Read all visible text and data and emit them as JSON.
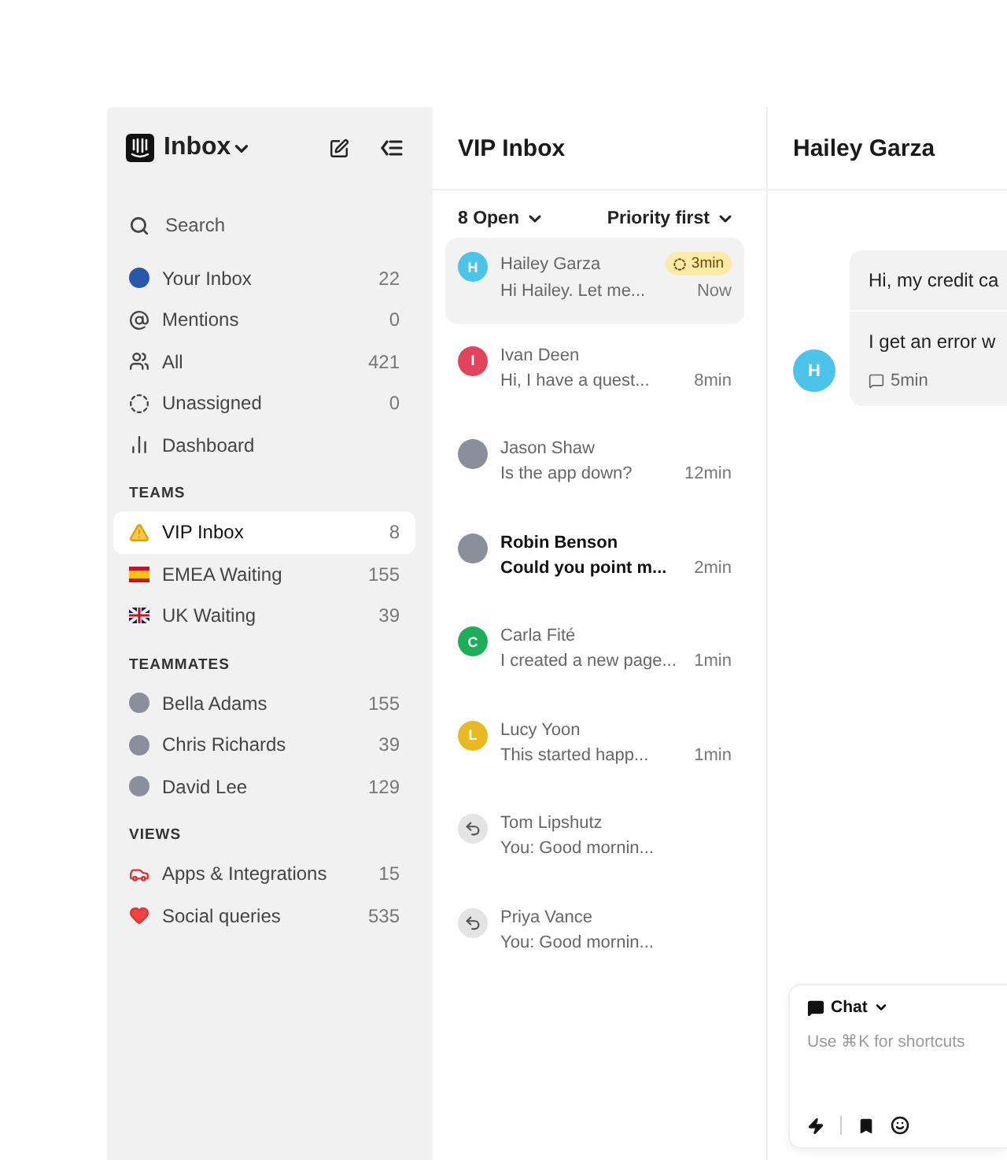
{
  "sidebar": {
    "title": "Inbox",
    "search": {
      "placeholder": "Search"
    },
    "items": [
      {
        "label": "Your Inbox",
        "count": "22",
        "kind": "user-avatar",
        "selected": false
      },
      {
        "label": "Mentions",
        "count": "0",
        "kind": "at",
        "selected": false
      },
      {
        "label": "All",
        "count": "421",
        "kind": "people",
        "selected": false
      },
      {
        "label": "Unassigned",
        "count": "0",
        "kind": "unassigned",
        "selected": false
      },
      {
        "label": "Dashboard",
        "kind": "chart",
        "selected": false
      }
    ],
    "sections": [
      {
        "title": "TEAMS",
        "items": [
          {
            "label": "VIP Inbox",
            "count": "8",
            "kind": "warning",
            "selected": true
          },
          {
            "label": "EMEA Waiting",
            "count": "155",
            "kind": "flag-es",
            "selected": false
          },
          {
            "label": "UK Waiting",
            "count": "39",
            "kind": "flag-uk",
            "selected": false
          }
        ]
      },
      {
        "title": "TEAMMATES",
        "items": [
          {
            "label": "Bella Adams",
            "count": "155",
            "kind": "photo",
            "selected": false
          },
          {
            "label": "Chris Richards",
            "count": "39",
            "kind": "photo",
            "selected": false
          },
          {
            "label": "David Lee",
            "count": "129",
            "kind": "photo",
            "selected": false
          }
        ]
      },
      {
        "title": "VIEWS",
        "items": [
          {
            "label": "Apps & Integrations",
            "count": "15",
            "kind": "car",
            "selected": false
          },
          {
            "label": "Social queries",
            "count": "535",
            "kind": "heart",
            "selected": false
          }
        ]
      }
    ]
  },
  "list": {
    "title": "VIP Inbox",
    "filter": "8 Open",
    "sort": "Priority first",
    "conversations": [
      {
        "name": "Hailey Garza",
        "preview": "Hi Hailey. Let me...",
        "time": "Now",
        "badge": "3min",
        "kind": "letter",
        "initial": "H",
        "color": "#4cc3e8",
        "selected": true,
        "unread": false
      },
      {
        "name": "Ivan Deen",
        "preview": "Hi, I have a quest...",
        "time": "8min",
        "kind": "letter",
        "initial": "I",
        "color": "#e2445c",
        "selected": false,
        "unread": false
      },
      {
        "name": "Jason Shaw",
        "preview": "Is the app down?",
        "time": "12min",
        "kind": "photo",
        "selected": false,
        "unread": false
      },
      {
        "name": "Robin Benson",
        "preview": "Could you point m...",
        "time": "2min",
        "kind": "photo",
        "selected": false,
        "unread": true
      },
      {
        "name": "Carla Fité",
        "preview": "I created a new page...",
        "time": "1min",
        "kind": "letter",
        "initial": "C",
        "color": "#1eae5a",
        "selected": false,
        "unread": false
      },
      {
        "name": "Lucy Yoon",
        "preview": "This started happ...",
        "time": "1min",
        "kind": "letter",
        "initial": "L",
        "color": "#e8b923",
        "selected": false,
        "unread": false
      },
      {
        "name": "Tom Lipshutz",
        "preview": "You: Good mornin...",
        "kind": "replied",
        "selected": false,
        "unread": false
      },
      {
        "name": "Priya Vance",
        "preview": "You: Good mornin...",
        "kind": "replied",
        "selected": false,
        "unread": false
      }
    ]
  },
  "conversation": {
    "title": "Hailey Garza",
    "avatar_initial": "H",
    "messages": [
      "Hi, my credit ca",
      "I get an error w"
    ],
    "time": "5min",
    "composer": {
      "mode": "Chat",
      "placeholder": "Use ⌘K for shortcuts"
    }
  }
}
